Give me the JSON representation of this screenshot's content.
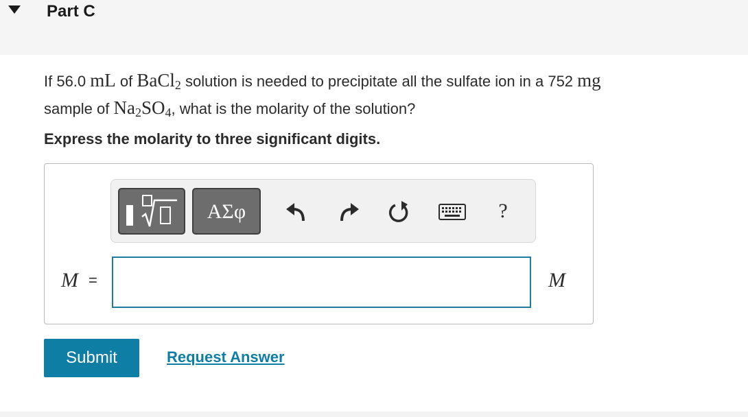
{
  "header": {
    "part_title": "Part C"
  },
  "question": {
    "t1": "If 56.0 ",
    "u1": "mL",
    "t2": " of ",
    "c1": "BaCl",
    "c1_sub": "2",
    "t3": " solution is needed to precipitate all the sulfate ion in a 752 ",
    "u2": "mg",
    "t4": " sample of ",
    "c2a": "Na",
    "c2a_sub": "2",
    "c2b": "SO",
    "c2b_sub": "4",
    "t5": ", what is the molarity of the solution?"
  },
  "instruction": "Express the molarity to three significant digits.",
  "toolbar": {
    "symbols_label": "ΑΣφ",
    "help_label": "?"
  },
  "answer": {
    "variable": "M",
    "equals": "=",
    "value": "",
    "unit": "M"
  },
  "actions": {
    "submit_label": "Submit",
    "request_label": "Request Answer"
  },
  "colors": {
    "accent": "#0f7ea5",
    "input_border": "#1f7aa0",
    "toolbar_button": "#6d6d6d",
    "header_bg": "#f5f5f5"
  }
}
